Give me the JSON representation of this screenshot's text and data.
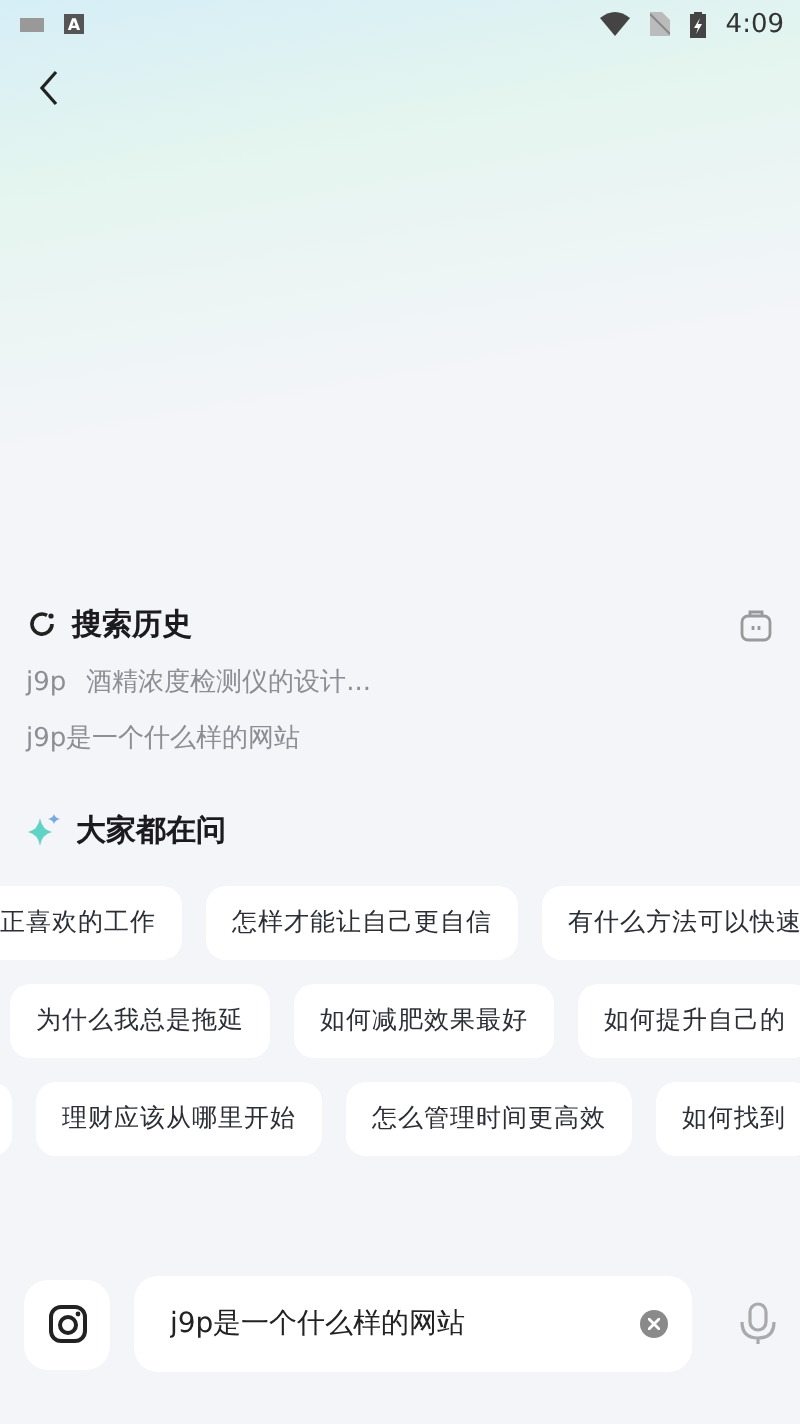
{
  "status_bar": {
    "time": "4:09",
    "keyboard_badge": "A"
  },
  "history": {
    "title": "搜索历史",
    "items": [
      {
        "prefix": "j9p",
        "text": "酒精浓度检测仪的设计..."
      },
      {
        "text": "j9p是一个什么样的网站"
      }
    ]
  },
  "popular": {
    "title": "大家都在问",
    "rows": [
      {
        "chips": [
          "正喜欢的工作",
          "怎样才能让自己更自信",
          "有什么方法可以快速"
        ]
      },
      {
        "chips": [
          "为什么我总是拖延",
          "如何减肥效果最好",
          "如何提升自己的"
        ]
      },
      {
        "chips": [
          "理财应该从哪里开始",
          "怎么管理时间更高效",
          "如何找到"
        ]
      }
    ]
  },
  "search_bar": {
    "value": "j9p是一个什么样的网站"
  }
}
